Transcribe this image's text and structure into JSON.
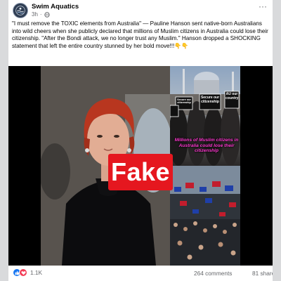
{
  "post": {
    "page_name": "Swim Aquatics",
    "time": "3h",
    "visibility_icon": "globe-icon",
    "more_icon": "more-options-icon",
    "caption": "\"I must remove the TOXIC elements from Australia\" — Pauline Hanson sent native-born Australians into wild cheers when she publicly declared that millions of Muslim citizens in Australia could lose their citizenship. \"After the Bondi attack, we no longer trust any Muslim.\" Hanson dropped a SHOCKING statement that left the entire country stunned by her bold move!!!👇👇"
  },
  "media": {
    "fake_label": "Fake",
    "protest_sign_1": "Secure our citizenship",
    "protest_sign_2": "Secure our citizenship",
    "protest_sign_3": "AU our country",
    "protest_caption": "Millions of Muslim citizens in Australia could lose their citizenship",
    "fake_label_color": "#e5171f"
  },
  "footer": {
    "reaction_icons": [
      "like-icon",
      "love-icon"
    ],
    "reaction_count": "1.1K",
    "comments": "264 comments",
    "shares": "81 shares"
  }
}
